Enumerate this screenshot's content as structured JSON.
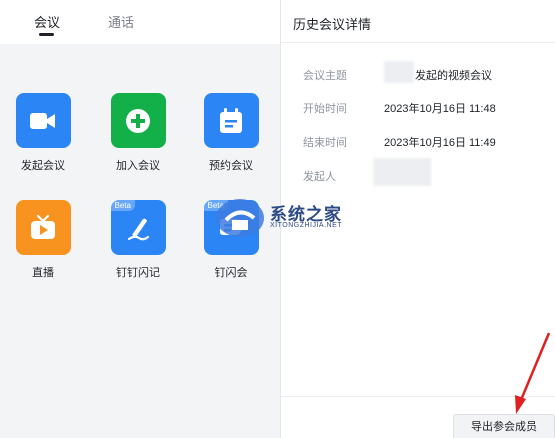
{
  "tabs": [
    {
      "label": "会议",
      "active": true
    },
    {
      "label": "通话",
      "active": false
    }
  ],
  "apps": [
    {
      "label": "发起会议",
      "icon": "video-camera-icon",
      "color": "#2b85f5"
    },
    {
      "label": "加入会议",
      "icon": "plus-circle-icon",
      "color": "#13b049"
    },
    {
      "label": "预约会议",
      "icon": "calendar-icon",
      "color": "#2b85f5"
    },
    {
      "label": "直播",
      "icon": "tv-play-icon",
      "color": "#f7931e"
    },
    {
      "label": "钉钉闪记",
      "icon": "pen-note-icon",
      "color": "#2b85f5",
      "badge": "Beta"
    },
    {
      "label": "钉闪会",
      "icon": "meeting-notes-icon",
      "color": "#2b85f5",
      "badge": "Beta"
    }
  ],
  "detail": {
    "title": "历史会议详情",
    "rows": [
      {
        "label": "会议主题",
        "value": "发起的视频会议"
      },
      {
        "label": "开始时间",
        "value": "2023年10月16日 11:48"
      },
      {
        "label": "结束时间",
        "value": "2023年10月16日 11:49"
      },
      {
        "label": "发起人",
        "value": ""
      }
    ],
    "export_button": "导出参会成员"
  },
  "watermark": {
    "title": "系统之家",
    "subtitle": "XITONGZHIJIA.NET"
  },
  "colors": {
    "accent_blue": "#2b85f5",
    "accent_green": "#13b049",
    "accent_orange": "#f7931e",
    "arrow_red": "#e02020"
  }
}
